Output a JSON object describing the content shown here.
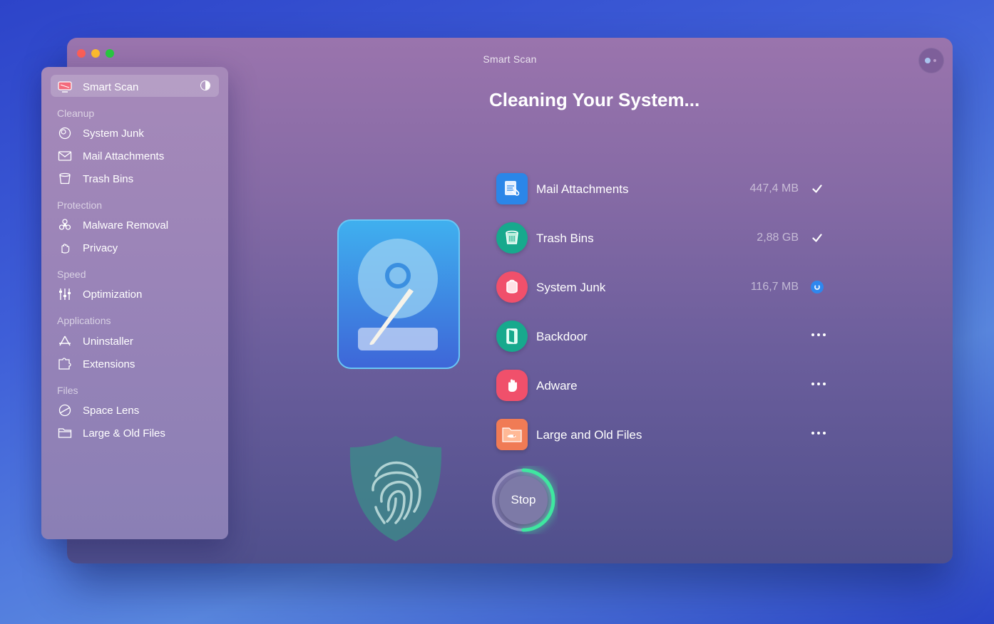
{
  "window": {
    "title": "Smart Scan"
  },
  "sidebar": {
    "smart_scan": "Smart Scan",
    "sections": {
      "cleanup": "Cleanup",
      "protection": "Protection",
      "speed": "Speed",
      "applications": "Applications",
      "files": "Files"
    },
    "items": {
      "system_junk": "System Junk",
      "mail_attachments": "Mail Attachments",
      "trash_bins": "Trash Bins",
      "malware_removal": "Malware Removal",
      "privacy": "Privacy",
      "optimization": "Optimization",
      "uninstaller": "Uninstaller",
      "extensions": "Extensions",
      "space_lens": "Space Lens",
      "large_old_files": "Large & Old Files"
    }
  },
  "main": {
    "heading": "Cleaning Your System...",
    "tasks": [
      {
        "label": "Mail Attachments",
        "size": "447,4 MB",
        "status": "done",
        "icon": "mail-attachments-icon",
        "color": "#2b86e8"
      },
      {
        "label": "Trash Bins",
        "size": "2,88 GB",
        "status": "done",
        "icon": "trash-bin-icon",
        "color": "#17a98d"
      },
      {
        "label": "System Junk",
        "size": "116,7 MB",
        "status": "in-progress",
        "icon": "system-junk-icon",
        "color": "#f0506b"
      },
      {
        "label": "Backdoor",
        "size": "",
        "status": "pending",
        "icon": "backdoor-icon",
        "color": "#17a98d"
      },
      {
        "label": "Adware",
        "size": "",
        "status": "pending",
        "icon": "adware-hand-icon",
        "color": "#f0506b"
      },
      {
        "label": "Large and Old Files",
        "size": "",
        "status": "pending",
        "icon": "large-old-files-folder-icon",
        "color": "#f07b55"
      }
    ],
    "stop_label": "Stop",
    "progress": 0.5
  },
  "colors": {
    "progress_ring": "#3fe7a0",
    "accent": "#2f87ee"
  }
}
